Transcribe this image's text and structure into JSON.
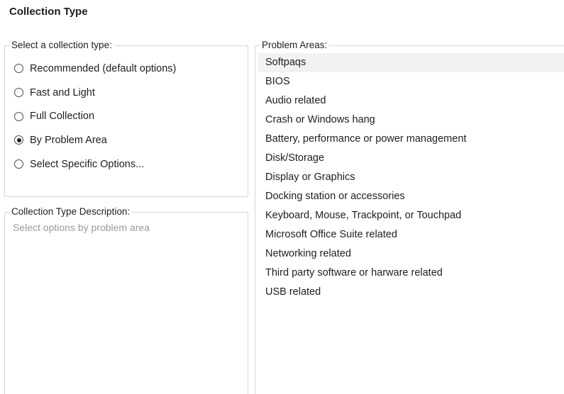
{
  "page": {
    "title": "Collection Type"
  },
  "collection_type": {
    "legend": "Select a collection type:",
    "options": [
      {
        "label": "Recommended (default options)",
        "checked": false
      },
      {
        "label": "Fast and Light",
        "checked": false
      },
      {
        "label": "Full Collection",
        "checked": false
      },
      {
        "label": "By Problem Area",
        "checked": true
      },
      {
        "label": "Select Specific Options...",
        "checked": false
      }
    ]
  },
  "description": {
    "legend": "Collection Type Description:",
    "text": "Select options by problem area"
  },
  "problem_areas": {
    "legend": "Problem Areas:",
    "items": [
      {
        "label": "Softpaqs",
        "selected": true
      },
      {
        "label": "BIOS",
        "selected": false
      },
      {
        "label": "Audio related",
        "selected": false
      },
      {
        "label": "Crash or Windows hang",
        "selected": false
      },
      {
        "label": "Battery, performance or power management",
        "selected": false
      },
      {
        "label": "Disk/Storage",
        "selected": false
      },
      {
        "label": "Display or Graphics",
        "selected": false
      },
      {
        "label": "Docking station or accessories",
        "selected": false
      },
      {
        "label": "Keyboard, Mouse, Trackpoint, or Touchpad",
        "selected": false
      },
      {
        "label": "Microsoft Office Suite related",
        "selected": false
      },
      {
        "label": "Networking related",
        "selected": false
      },
      {
        "label": "Third party software or harware related",
        "selected": false
      },
      {
        "label": "USB related",
        "selected": false
      }
    ]
  },
  "colors": {
    "text": "#1e1e1e",
    "placeholder_text": "#9a9a9a",
    "group_border": "#d6d6d6",
    "selected_row": "#f2f2f2"
  }
}
